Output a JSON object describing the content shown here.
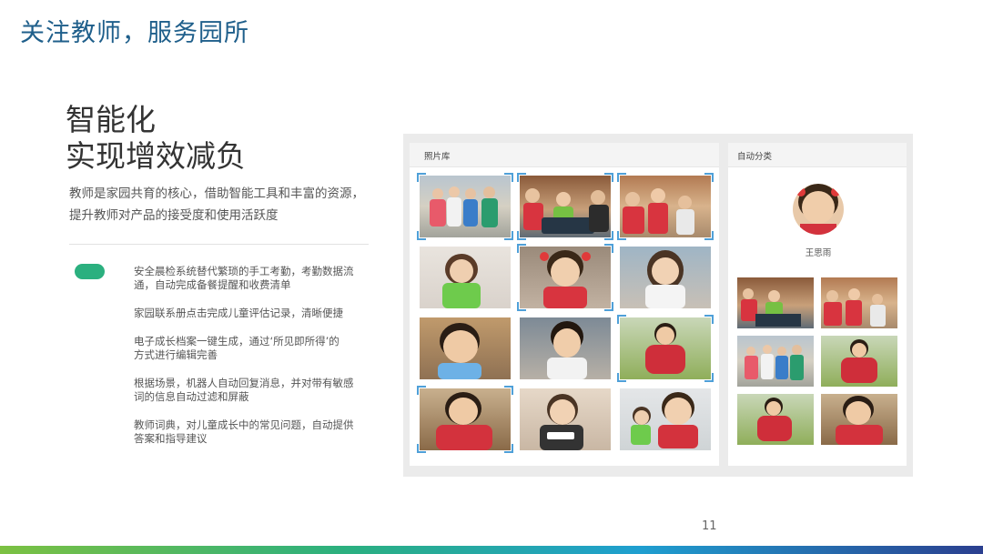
{
  "header": {
    "title": "关注教师，服务园所"
  },
  "headline": {
    "line1": "智能化",
    "line2": "实现增效减负"
  },
  "intro": {
    "line1": "教师是家园共育的核心，借助智能工具和丰富的资源，",
    "line2": "提升教师对产品的接受度和使用活跃度"
  },
  "features": [
    {
      "line1": "安全晨检系统替代繁琐的手工考勤，考勤数据流",
      "line2": "通，自动完成备餐提醒和收费清单"
    },
    {
      "line1": "家园联系册点击完成儿童评估记录，清晰便捷",
      "line2": ""
    },
    {
      "line1": "电子成长档案一键生成，通过‘所见即所得’的",
      "line2": "方式进行编辑完善"
    },
    {
      "line1": "根据场景，机器人自动回复消息，并对带有敏感",
      "line2": "词的信息自动过滤和屏蔽"
    },
    {
      "line1": "教师词典，对儿童成长中的常见问题，自动提供",
      "line2": "答案和指导建议"
    }
  ],
  "photo_library": {
    "title": "照片库"
  },
  "auto_classify": {
    "title": "自动分类",
    "person_name": "王思雨"
  },
  "page_number": "11",
  "colors": {
    "accent_green": "#2bb07f",
    "title_blue": "#1f5f8b",
    "selection_blue": "#4fa0d8"
  }
}
